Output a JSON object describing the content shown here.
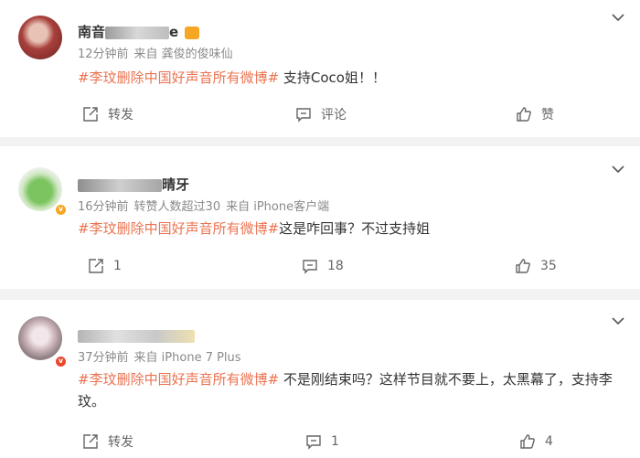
{
  "comments": [
    {
      "name_visible": "南音",
      "name_tail": "e",
      "time": "12分钟前",
      "extra": "",
      "source": "来自 龚俊的俊味仙",
      "topic": "#李玟删除中国好声音所有微博#",
      "text": " 支持Coco姐！！",
      "text2": "",
      "repost_label": "转发",
      "comment_label": "评论",
      "like_label": "赞"
    },
    {
      "name_tail": "晴牙",
      "time": "16分钟前",
      "extra": "转赞人数超过30",
      "source": "来自 iPhone客户端",
      "topic": "#李玟删除中国好声音所有微博#",
      "text": "这是咋回事？不过支持姐",
      "text2": "",
      "repost_count": "1",
      "comment_count": "18",
      "like_count": "35"
    },
    {
      "time": "37分钟前",
      "extra": "",
      "source": "来自 iPhone 7 Plus",
      "topic": "#李玟删除中国好声音所有微博#",
      "text": " 不是刚结束吗？这样节目就不要上，太黑幕了，支持李",
      "text2": "玟。",
      "repost_label": "转发",
      "comment_count": "1",
      "like_count": "4"
    }
  ],
  "colors": {
    "topic": "#eb7350",
    "meta": "#8a8a8a",
    "separator": "#f2f2f2"
  }
}
